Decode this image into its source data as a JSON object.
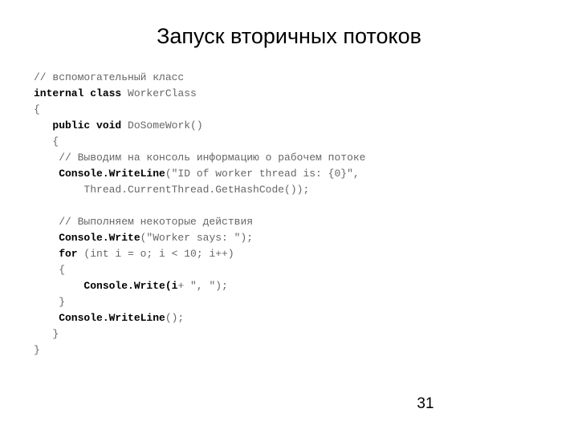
{
  "slide": {
    "title": "Запуск вторичных потоков",
    "number": "31",
    "colors": {
      "background": "#ffffff",
      "title_text": "#000000",
      "code_plain": "#666666",
      "code_keyword": "#000000",
      "slide_number": "#000000"
    },
    "code": {
      "language": "csharp",
      "lines": [
        {
          "indent": "",
          "tokens": [
            {
              "type": "plain",
              "text": "// вспомогательный класс"
            }
          ]
        },
        {
          "indent": "",
          "tokens": [
            {
              "type": "kw",
              "text": "internal class "
            },
            {
              "type": "plain",
              "text": "WorkerClass"
            }
          ]
        },
        {
          "indent": "",
          "tokens": [
            {
              "type": "brace",
              "text": "{"
            }
          ]
        },
        {
          "indent": "   ",
          "tokens": [
            {
              "type": "kw",
              "text": "public void "
            },
            {
              "type": "plain",
              "text": "DoSomeWork()"
            }
          ]
        },
        {
          "indent": "   ",
          "tokens": [
            {
              "type": "brace",
              "text": "{"
            }
          ]
        },
        {
          "indent": "    ",
          "tokens": [
            {
              "type": "plain",
              "text": "// Выводим на консоль информацию о рабочем потоке"
            }
          ]
        },
        {
          "indent": "    ",
          "tokens": [
            {
              "type": "kw",
              "text": "Console.WriteLine"
            },
            {
              "type": "plain",
              "text": "(\"ID of worker thread is: {0}\","
            }
          ]
        },
        {
          "indent": "        ",
          "tokens": [
            {
              "type": "plain",
              "text": "Thread.CurrentThread.GetHashCode());"
            }
          ]
        },
        {
          "indent": "",
          "tokens": []
        },
        {
          "indent": "    ",
          "tokens": [
            {
              "type": "plain",
              "text": "// Выполняем некоторые действия"
            }
          ]
        },
        {
          "indent": "    ",
          "tokens": [
            {
              "type": "kw",
              "text": "Console.Write"
            },
            {
              "type": "plain",
              "text": "(\"Worker says: \");"
            }
          ]
        },
        {
          "indent": "    ",
          "tokens": [
            {
              "type": "kw",
              "text": "for "
            },
            {
              "type": "plain",
              "text": "(int i = o; i < 10; i++)"
            }
          ]
        },
        {
          "indent": "    ",
          "tokens": [
            {
              "type": "brace",
              "text": "{"
            }
          ]
        },
        {
          "indent": "        ",
          "tokens": [
            {
              "type": "kw",
              "text": "Console.Write(i"
            },
            {
              "type": "plain",
              "text": "+ \", \");"
            }
          ]
        },
        {
          "indent": "    ",
          "tokens": [
            {
              "type": "brace",
              "text": "}"
            }
          ]
        },
        {
          "indent": "    ",
          "tokens": [
            {
              "type": "kw",
              "text": "Console.WriteLine"
            },
            {
              "type": "plain",
              "text": "();"
            }
          ]
        },
        {
          "indent": "   ",
          "tokens": [
            {
              "type": "brace",
              "text": "}"
            }
          ]
        },
        {
          "indent": "",
          "tokens": [
            {
              "type": "brace",
              "text": "}"
            }
          ]
        }
      ]
    }
  }
}
